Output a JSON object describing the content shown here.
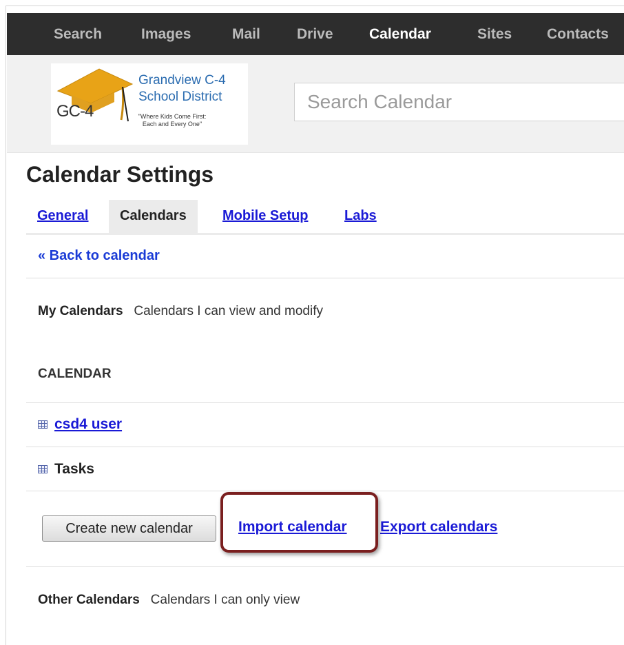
{
  "nav": {
    "items": [
      {
        "label": "Search",
        "active": false
      },
      {
        "label": "Images",
        "active": false
      },
      {
        "label": "Mail",
        "active": false
      },
      {
        "label": "Drive",
        "active": false
      },
      {
        "label": "Calendar",
        "active": true
      },
      {
        "label": "Sites",
        "active": false
      },
      {
        "label": "Contacts",
        "active": false
      }
    ]
  },
  "logo": {
    "line1": "Grandview C-4",
    "line2": "School District",
    "tagline": "\"Where Kids Come First: Each and Every One\"",
    "mark": "GC-4"
  },
  "search": {
    "placeholder": "Search Calendar"
  },
  "page": {
    "title": "Calendar Settings"
  },
  "tabs": [
    {
      "label": "General",
      "active": false
    },
    {
      "label": "Calendars",
      "active": true
    },
    {
      "label": "Mobile Setup",
      "active": false
    },
    {
      "label": "Labs",
      "active": false
    }
  ],
  "back_link": "« Back to calendar",
  "my_calendars": {
    "title": "My Calendars",
    "subtitle": "Calendars I can view and modify"
  },
  "column_header": "CALENDAR",
  "calendars": [
    {
      "name": "csd4 user",
      "is_link": true,
      "icon": "calendar-grid-icon"
    },
    {
      "name": "Tasks",
      "is_link": false,
      "icon": "calendar-grid-icon"
    }
  ],
  "actions": {
    "create": "Create new calendar",
    "import": "Import calendar",
    "export": "Export calendars"
  },
  "other_calendars": {
    "title": "Other Calendars",
    "subtitle": "Calendars I can only view"
  },
  "colors": {
    "nav_bg": "#2d2d2d",
    "link": "#1a1ad6",
    "highlight": "#7a1f1f",
    "logo_blue": "#2b6cb0",
    "logo_gold": "#e8a317"
  }
}
